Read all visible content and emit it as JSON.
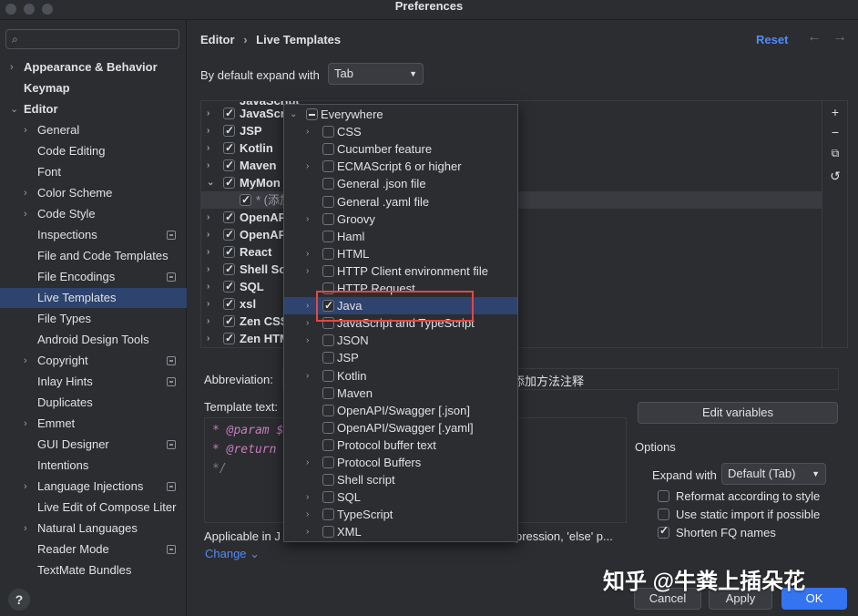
{
  "window": {
    "title": "Preferences"
  },
  "search": {
    "placeholder": ""
  },
  "sidebar": {
    "items": [
      {
        "label": "Appearance & Behavior"
      },
      {
        "label": "Keymap"
      },
      {
        "label": "Editor"
      },
      {
        "label": "General"
      },
      {
        "label": "Code Editing"
      },
      {
        "label": "Font"
      },
      {
        "label": "Color Scheme"
      },
      {
        "label": "Code Style"
      },
      {
        "label": "Inspections"
      },
      {
        "label": "File and Code Templates"
      },
      {
        "label": "File Encodings"
      },
      {
        "label": "Live Templates"
      },
      {
        "label": "File Types"
      },
      {
        "label": "Android Design Tools"
      },
      {
        "label": "Copyright"
      },
      {
        "label": "Inlay Hints"
      },
      {
        "label": "Duplicates"
      },
      {
        "label": "Emmet"
      },
      {
        "label": "GUI Designer"
      },
      {
        "label": "Intentions"
      },
      {
        "label": "Language Injections"
      },
      {
        "label": "Live Edit of Compose Liter"
      },
      {
        "label": "Natural Languages"
      },
      {
        "label": "Reader Mode"
      },
      {
        "label": "TextMate Bundles"
      }
    ],
    "help": "?"
  },
  "header": {
    "crumb_editor": "Editor",
    "crumb_sep": "›",
    "crumb_page": "Live Templates",
    "reset": "Reset",
    "back": "←",
    "forward": "→"
  },
  "expand": {
    "label": "By default expand with",
    "value": "Tab"
  },
  "tree": {
    "groups": [
      "JavaScript",
      "JavaScri",
      "JSP",
      "Kotlin",
      "Maven",
      "MyMon",
      "OpenAP",
      "OpenAP",
      "React",
      "Shell Sc",
      "SQL",
      "xsl",
      "Zen CSS",
      "Zen HTM"
    ],
    "child": "* (添加"
  },
  "details": {
    "abbreviation_label": "Abbreviation:",
    "description_tail": "添加方法注释",
    "template_label": "Template text:",
    "code": [
      "* @param $",
      "* @return",
      "*/"
    ],
    "applicable": "Applicable in J",
    "applicable_tail": "pression, 'else' p...",
    "change": "Change ⌄",
    "edit_variables": "Edit variables",
    "options_title": "Options",
    "expand_with_label": "Expand with",
    "expand_with_value": "Default (Tab)",
    "opt_reformat": "Reformat according to style",
    "opt_static": "Use static import if possible",
    "opt_shorten": "Shorten FQ names"
  },
  "popup": {
    "items": [
      {
        "label": "Everywhere",
        "arrow": "⌄",
        "state": "mixed"
      },
      {
        "label": "CSS",
        "arrow": "›",
        "state": "off"
      },
      {
        "label": "Cucumber feature",
        "arrow": "",
        "state": "off"
      },
      {
        "label": "ECMAScript 6 or higher",
        "arrow": "›",
        "state": "off"
      },
      {
        "label": "General .json file",
        "arrow": "",
        "state": "off"
      },
      {
        "label": "General .yaml file",
        "arrow": "",
        "state": "off"
      },
      {
        "label": "Groovy",
        "arrow": "›",
        "state": "off"
      },
      {
        "label": "Haml",
        "arrow": "",
        "state": "off"
      },
      {
        "label": "HTML",
        "arrow": "›",
        "state": "off"
      },
      {
        "label": "HTTP Client environment file",
        "arrow": "›",
        "state": "off"
      },
      {
        "label": "HTTP Request",
        "arrow": "",
        "state": "off"
      },
      {
        "label": "Java",
        "arrow": "›",
        "state": "on"
      },
      {
        "label": "JavaScript and TypeScript",
        "arrow": "›",
        "state": "off"
      },
      {
        "label": "JSON",
        "arrow": "›",
        "state": "off"
      },
      {
        "label": "JSP",
        "arrow": "",
        "state": "off"
      },
      {
        "label": "Kotlin",
        "arrow": "›",
        "state": "off"
      },
      {
        "label": "Maven",
        "arrow": "",
        "state": "off"
      },
      {
        "label": "OpenAPI/Swagger [.json]",
        "arrow": "",
        "state": "off"
      },
      {
        "label": "OpenAPI/Swagger [.yaml]",
        "arrow": "",
        "state": "off"
      },
      {
        "label": "Protocol buffer text",
        "arrow": "",
        "state": "off"
      },
      {
        "label": "Protocol Buffers",
        "arrow": "›",
        "state": "off"
      },
      {
        "label": "Shell script",
        "arrow": "",
        "state": "off"
      },
      {
        "label": "SQL",
        "arrow": "›",
        "state": "off"
      },
      {
        "label": "TypeScript",
        "arrow": "›",
        "state": "off"
      },
      {
        "label": "XML",
        "arrow": "›",
        "state": "off"
      }
    ]
  },
  "footer": {
    "cancel": "Cancel",
    "apply": "Apply",
    "ok": "OK"
  },
  "watermark": "知乎 @牛粪上插朵花",
  "colors": {
    "accent": "#3574f0",
    "selection": "#2e436e",
    "highlight_box": "#e04848",
    "background": "#2b2d30"
  }
}
